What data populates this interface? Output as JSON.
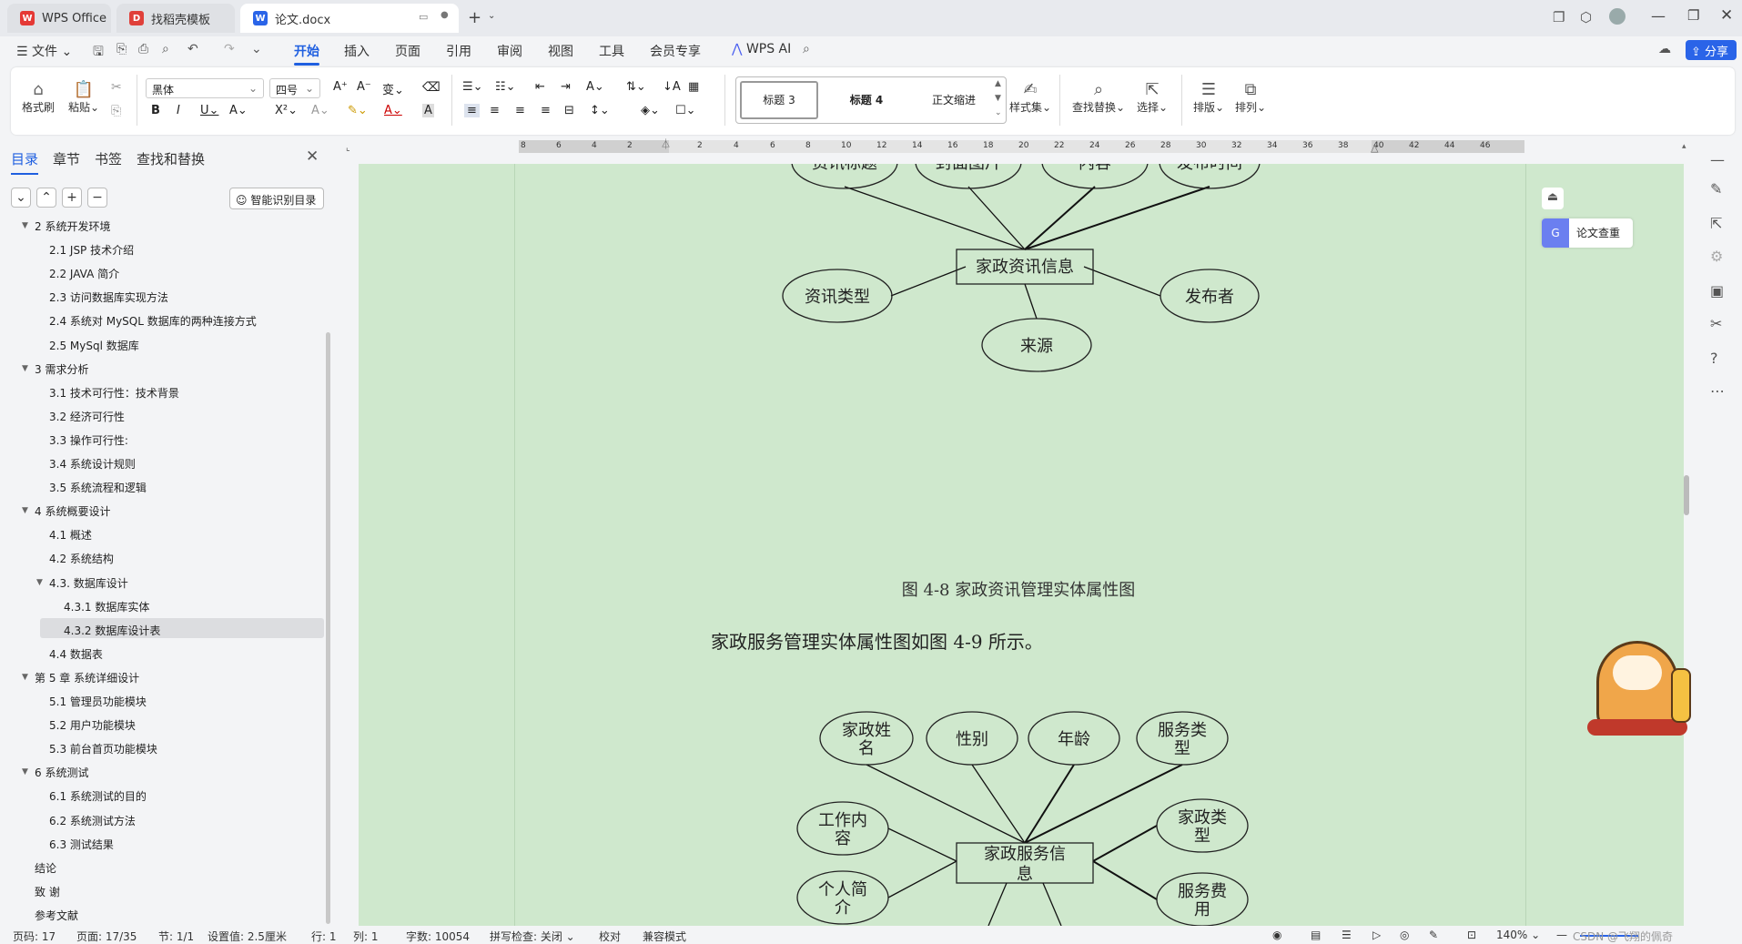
{
  "tabs": [
    {
      "label": "WPS Office",
      "icon": "wps-logo-icon"
    },
    {
      "label": "找稻壳模板",
      "icon": "docer-icon"
    },
    {
      "label": "论文.docx",
      "icon": "word-doc-icon"
    }
  ],
  "menu": {
    "file": "文件",
    "items": [
      "开始",
      "插入",
      "页面",
      "引用",
      "审阅",
      "视图",
      "工具",
      "会员专享"
    ],
    "wpsai": "WPS AI",
    "share": "分享"
  },
  "ribbon": {
    "format_painter": "格式刷",
    "paste": "粘贴",
    "font": "黑体",
    "size": "四号",
    "styles": [
      "标题 3",
      "标题 4",
      "正文缩进"
    ],
    "style_set": "样式集",
    "find_replace": "查找替换",
    "select": "选择",
    "layout": "排版",
    "arrange": "排列"
  },
  "nav": {
    "tabs": [
      "目录",
      "章节",
      "书签",
      "查找和替换"
    ],
    "smart_toc": "智能识别目录",
    "toc": [
      {
        "text": "2 系统开发环境",
        "level": 1
      },
      {
        "text": "2.1 JSP 技术介绍",
        "level": 2
      },
      {
        "text": "2.2 JAVA 简介",
        "level": 2
      },
      {
        "text": "2.3 访问数据库实现方法",
        "level": 2
      },
      {
        "text": "2.4 系统对 MySQL 数据库的两种连接方式",
        "level": 2
      },
      {
        "text": "2.5 MySql 数据库",
        "level": 2
      },
      {
        "text": "3  需求分析",
        "level": 1
      },
      {
        "text": "3.1 技术可行性：技术背景",
        "level": 2
      },
      {
        "text": "3.2 经济可行性",
        "level": 2
      },
      {
        "text": "3.3 操作可行性:",
        "level": 2
      },
      {
        "text": "3.4 系统设计规则",
        "level": 2
      },
      {
        "text": "3.5 系统流程和逻辑",
        "level": 2
      },
      {
        "text": "4 系统概要设计",
        "level": 1
      },
      {
        "text": "4.1  概述",
        "level": 2
      },
      {
        "text": "4.2  系统结构",
        "level": 2
      },
      {
        "text": "4.3.  数据库设计",
        "level": 2
      },
      {
        "text": "4.3.1  数据库实体",
        "level": 3
      },
      {
        "text": "4.3.2  数据库设计表",
        "level": 3
      },
      {
        "text": "4.4  数据表",
        "level": 2
      },
      {
        "text": "第 5 章  系统详细设计",
        "level": 1
      },
      {
        "text": "5.1 管理员功能模块",
        "level": 2
      },
      {
        "text": "5.2 用户功能模块",
        "level": 2
      },
      {
        "text": "5.3 前台首页功能模块",
        "level": 2
      },
      {
        "text": "6  系统测试",
        "level": 1
      },
      {
        "text": "6.1 系统测试的目的",
        "level": 2
      },
      {
        "text": "6.2 系统测试方法",
        "level": 2
      },
      {
        "text": "6.3  测试结果",
        "level": 2
      },
      {
        "text": "结论",
        "level": 1
      },
      {
        "text": "致   谢",
        "level": 1
      },
      {
        "text": "参考文献",
        "level": 1
      }
    ]
  },
  "ruler": [
    "8",
    "6",
    "4",
    "2",
    "2",
    "4",
    "6",
    "8",
    "10",
    "12",
    "14",
    "16",
    "18",
    "20",
    "22",
    "24",
    "26",
    "28",
    "30",
    "32",
    "34",
    "36",
    "38",
    "40",
    "42",
    "44",
    "46"
  ],
  "diagram1": {
    "center": "家政资讯信息",
    "attrs": [
      "资讯标题",
      "封面图片",
      "内容",
      "发布时间",
      "资讯类型",
      "发布者",
      "来源"
    ],
    "caption": "图 4-8 家政资讯管理实体属性图"
  },
  "body_text": "家政服务管理实体属性图如图 4-9 所示。",
  "diagram2": {
    "center": [
      "家政服务信",
      "息"
    ],
    "attrs": [
      [
        "家政姓",
        "名"
      ],
      [
        "性别"
      ],
      [
        "年龄"
      ],
      [
        "服务类",
        "型"
      ],
      [
        "工作内",
        "容"
      ],
      [
        "家政类",
        "型"
      ],
      [
        "个人简",
        "介"
      ],
      [
        "服务费",
        "用"
      ]
    ]
  },
  "float": {
    "check": "论文查重"
  },
  "status": {
    "page": "页码: 17",
    "pages": "页面: 17/35",
    "section": "节: 1/1",
    "setting": "设置值: 2.5厘米",
    "row": "行: 1",
    "col": "列: 1",
    "words": "字数: 10054",
    "spell": "拼写检查: 关闭",
    "proof": "校对",
    "compat": "兼容模式",
    "zoom": "140%",
    "watermark": "CSDN @飞翔的佩奇"
  }
}
